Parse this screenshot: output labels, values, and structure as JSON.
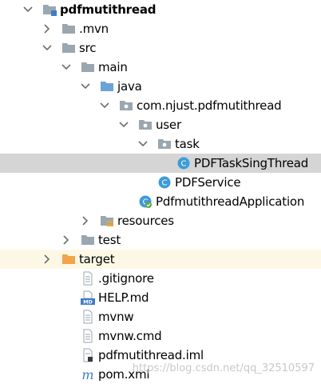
{
  "tree": {
    "items": [
      {
        "label": "pdfmutithread",
        "depth": 0,
        "expanded": true,
        "icon": "module-folder-icon",
        "bold": true,
        "slug": "pdfmutithread"
      },
      {
        "label": ".mvn",
        "depth": 1,
        "expanded": false,
        "icon": "folder-icon",
        "slug": "mvn"
      },
      {
        "label": "src",
        "depth": 1,
        "expanded": true,
        "icon": "folder-icon",
        "slug": "src"
      },
      {
        "label": "main",
        "depth": 2,
        "expanded": true,
        "icon": "folder-icon",
        "slug": "main"
      },
      {
        "label": "java",
        "depth": 3,
        "expanded": true,
        "icon": "source-folder-icon",
        "slug": "java"
      },
      {
        "label": "com.njust.pdfmutithread",
        "depth": 4,
        "expanded": true,
        "icon": "package-icon",
        "slug": "com-njust-pdfmutithread"
      },
      {
        "label": "user",
        "depth": 5,
        "expanded": true,
        "icon": "package-icon",
        "slug": "user"
      },
      {
        "label": "task",
        "depth": 6,
        "expanded": true,
        "icon": "package-icon",
        "slug": "task"
      },
      {
        "label": "PDFTaskSingThread",
        "depth": 7,
        "icon": "java-class-icon",
        "selected": true,
        "slug": "pdftasksingthread"
      },
      {
        "label": "PDFService",
        "depth": 6,
        "icon": "java-class-icon",
        "slug": "pdfservice"
      },
      {
        "label": "PdfmutithreadApplication",
        "depth": 5,
        "icon": "spring-boot-class-icon",
        "slug": "pdfmutithreadapplication"
      },
      {
        "label": "resources",
        "depth": 3,
        "expanded": false,
        "icon": "resources-folder-icon",
        "slug": "resources"
      },
      {
        "label": "test",
        "depth": 2,
        "expanded": false,
        "icon": "folder-icon",
        "slug": "test"
      },
      {
        "label": "target",
        "depth": 1,
        "expanded": false,
        "icon": "excluded-folder-icon",
        "highlight": true,
        "slug": "target"
      },
      {
        "label": ".gitignore",
        "depth": 2,
        "icon": "text-file-icon",
        "slug": "gitignore"
      },
      {
        "label": "HELP.md",
        "depth": 2,
        "icon": "markdown-file-icon",
        "slug": "help-md"
      },
      {
        "label": "mvnw",
        "depth": 2,
        "icon": "text-file-icon",
        "slug": "mvnw"
      },
      {
        "label": "mvnw.cmd",
        "depth": 2,
        "icon": "text-file-icon",
        "slug": "mvnw-cmd"
      },
      {
        "label": "pdfmutithread.iml",
        "depth": 2,
        "icon": "iml-file-icon",
        "slug": "pdfmutithread-iml"
      },
      {
        "label": "pom.xml",
        "depth": 2,
        "icon": "maven-file-icon",
        "slug": "pom-xml"
      }
    ]
  },
  "colors": {
    "selection": "#d5d5d5",
    "highlight": "#fdf8e6",
    "folder": "#9aa7b0",
    "source_folder": "#6ba3d6",
    "class_circle": "#3d9cd9",
    "excluded_folder": "#f3a44a"
  },
  "watermark": "https://blog.csdn.net/qq_32510597"
}
